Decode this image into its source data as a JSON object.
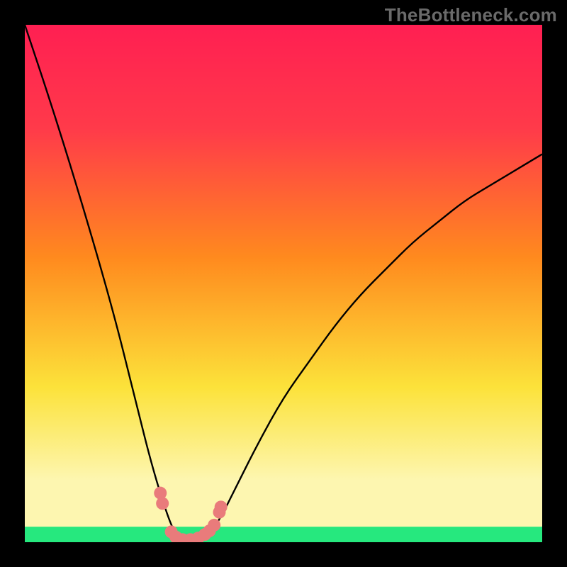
{
  "watermark": "TheBottleneck.com",
  "colors": {
    "bg_black": "#000000",
    "curve": "#000000",
    "dots": "#e97b7b",
    "green_band": "#26e87e",
    "pale_yellow": "#fdf6b0",
    "yellow": "#fce23a",
    "orange": "#ff8a1e",
    "red_top": "#ff1f52",
    "red_mid": "#ff3a4a"
  },
  "chart_data": {
    "type": "line",
    "title": "",
    "xlabel": "",
    "ylabel": "",
    "xlim": [
      0,
      100
    ],
    "ylim": [
      0,
      100
    ],
    "grid": false,
    "series": [
      {
        "name": "bottleneck-curve",
        "x": [
          0,
          5,
          10,
          15,
          18,
          20,
          22,
          24,
          26,
          28,
          29,
          30,
          31,
          32,
          34,
          36,
          38,
          40,
          45,
          50,
          55,
          60,
          65,
          70,
          75,
          80,
          85,
          90,
          95,
          100
        ],
        "values": [
          100,
          85,
          69,
          52,
          41,
          33,
          25,
          17,
          10,
          4,
          2,
          0,
          0,
          0,
          0,
          2,
          5,
          9,
          19,
          28,
          35,
          42,
          48,
          53,
          58,
          62,
          66,
          69,
          72,
          75
        ]
      }
    ],
    "scatter": {
      "name": "highlight-dots",
      "points": [
        {
          "x": 26.2,
          "y": 9.5
        },
        {
          "x": 26.6,
          "y": 7.5
        },
        {
          "x": 28.3,
          "y": 2.0
        },
        {
          "x": 29.2,
          "y": 1.0
        },
        {
          "x": 30.5,
          "y": 0.5
        },
        {
          "x": 32.0,
          "y": 0.5
        },
        {
          "x": 33.5,
          "y": 0.8
        },
        {
          "x": 34.8,
          "y": 1.5
        },
        {
          "x": 35.7,
          "y": 2.2
        },
        {
          "x": 36.6,
          "y": 3.3
        },
        {
          "x": 37.6,
          "y": 5.8
        },
        {
          "x": 37.9,
          "y": 6.8
        }
      ]
    },
    "bands": [
      {
        "name": "green",
        "from": 0,
        "to": 3,
        "color": "#26e87e"
      },
      {
        "name": "pale-yellow",
        "from": 3,
        "to": 12,
        "color": "#fdf6b0"
      }
    ],
    "gradient_stops": [
      {
        "offset": 0.0,
        "color": "#ff1f52"
      },
      {
        "offset": 0.2,
        "color": "#ff3a4a"
      },
      {
        "offset": 0.45,
        "color": "#ff8a1e"
      },
      {
        "offset": 0.7,
        "color": "#fce23a"
      },
      {
        "offset": 0.88,
        "color": "#fdf6b0"
      },
      {
        "offset": 0.97,
        "color": "#c6f7a0"
      },
      {
        "offset": 1.0,
        "color": "#26e87e"
      }
    ]
  }
}
